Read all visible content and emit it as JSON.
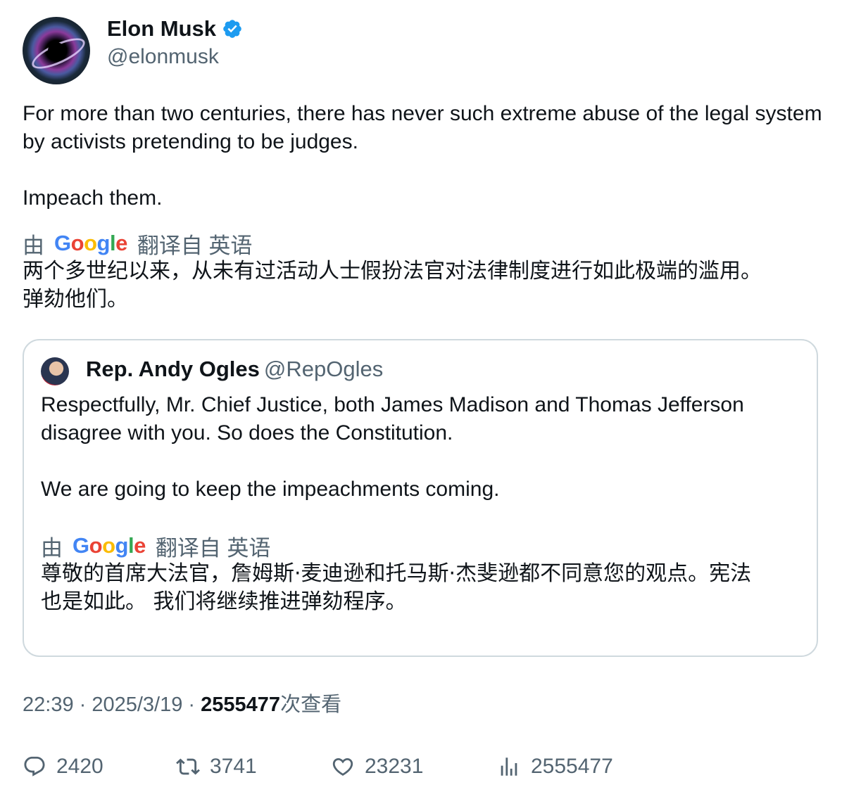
{
  "author": {
    "name": "Elon Musk",
    "handle": "@elonmusk",
    "verified_color": "#1d9bf0"
  },
  "post": {
    "paragraphs": [
      "For more than two centuries, there has never such extreme abuse of the legal system by activists pretending to be judges.",
      "Impeach them."
    ],
    "translation": {
      "by": "由",
      "service": "Google",
      "from": "翻译自 英语",
      "text_lines": [
        "两个多世纪以来，从未有过活动人士假扮法官对法律制度进行如此极端的滥用。",
        "弹劾他们。"
      ]
    }
  },
  "quote": {
    "name": "Rep. Andy Ogles",
    "handle": "@RepOgles",
    "paragraphs": [
      "Respectfully, Mr. Chief Justice, both James Madison and Thomas Jefferson disagree with you. So does the Constitution.",
      "We are going to keep the impeachments coming."
    ],
    "translation": {
      "by": "由",
      "service": "Google",
      "from": "翻译自 英语",
      "text_lines": [
        "尊敬的首席大法官，詹姆斯·麦迪逊和托马斯·杰斐逊都不同意您的观点。宪法",
        "也是如此。 我们将继续推进弹劾程序。"
      ]
    }
  },
  "meta": {
    "time": "22:39",
    "sep": " · ",
    "date": "2025/3/19",
    "views_num": "2555477",
    "views_label": "次查看"
  },
  "actions": {
    "replies": "2420",
    "reposts": "3741",
    "likes": "23231",
    "views": "2555477"
  },
  "icons": [
    "verified-badge-icon",
    "reply-icon",
    "repost-icon",
    "like-icon",
    "views-icon"
  ]
}
